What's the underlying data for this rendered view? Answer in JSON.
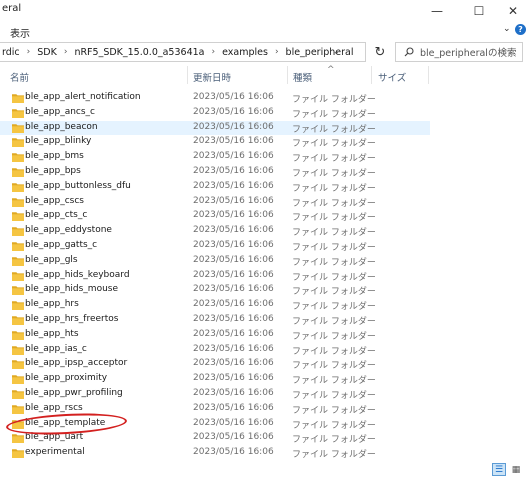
{
  "window": {
    "title": "eral",
    "minimize_glyph": "—",
    "maximize_glyph": "☐",
    "close_glyph": "✕"
  },
  "menu": {
    "view": "表示",
    "expand_glyph": "⌄",
    "help_glyph": "?"
  },
  "address": {
    "crumbs": [
      "rdic",
      "SDK",
      "nRF5_SDK_15.0.0_a53641a",
      "examples",
      "ble_peripheral"
    ],
    "separator": "›",
    "dropdown_glyph": "⌄",
    "refresh_glyph": "↻"
  },
  "search": {
    "placeholder": "ble_peripheralの検索"
  },
  "columns": {
    "name": "名前",
    "modified": "更新日時",
    "type": "種類",
    "size": "サイズ",
    "sort_glyph": "^"
  },
  "files": [
    {
      "name": "ble_app_alert_notification",
      "date": "2023/05/16 16:06",
      "type": "ファイル フォルダー"
    },
    {
      "name": "ble_app_ancs_c",
      "date": "2023/05/16 16:06",
      "type": "ファイル フォルダー"
    },
    {
      "name": "ble_app_beacon",
      "date": "2023/05/16 16:06",
      "type": "ファイル フォルダー"
    },
    {
      "name": "ble_app_blinky",
      "date": "2023/05/16 16:06",
      "type": "ファイル フォルダー"
    },
    {
      "name": "ble_app_bms",
      "date": "2023/05/16 16:06",
      "type": "ファイル フォルダー"
    },
    {
      "name": "ble_app_bps",
      "date": "2023/05/16 16:06",
      "type": "ファイル フォルダー"
    },
    {
      "name": "ble_app_buttonless_dfu",
      "date": "2023/05/16 16:06",
      "type": "ファイル フォルダー"
    },
    {
      "name": "ble_app_cscs",
      "date": "2023/05/16 16:06",
      "type": "ファイル フォルダー"
    },
    {
      "name": "ble_app_cts_c",
      "date": "2023/05/16 16:06",
      "type": "ファイル フォルダー"
    },
    {
      "name": "ble_app_eddystone",
      "date": "2023/05/16 16:06",
      "type": "ファイル フォルダー"
    },
    {
      "name": "ble_app_gatts_c",
      "date": "2023/05/16 16:06",
      "type": "ファイル フォルダー"
    },
    {
      "name": "ble_app_gls",
      "date": "2023/05/16 16:06",
      "type": "ファイル フォルダー"
    },
    {
      "name": "ble_app_hids_keyboard",
      "date": "2023/05/16 16:06",
      "type": "ファイル フォルダー"
    },
    {
      "name": "ble_app_hids_mouse",
      "date": "2023/05/16 16:06",
      "type": "ファイル フォルダー"
    },
    {
      "name": "ble_app_hrs",
      "date": "2023/05/16 16:06",
      "type": "ファイル フォルダー"
    },
    {
      "name": "ble_app_hrs_freertos",
      "date": "2023/05/16 16:06",
      "type": "ファイル フォルダー"
    },
    {
      "name": "ble_app_hts",
      "date": "2023/05/16 16:06",
      "type": "ファイル フォルダー"
    },
    {
      "name": "ble_app_ias_c",
      "date": "2023/05/16 16:06",
      "type": "ファイル フォルダー"
    },
    {
      "name": "ble_app_ipsp_acceptor",
      "date": "2023/05/16 16:06",
      "type": "ファイル フォルダー"
    },
    {
      "name": "ble_app_proximity",
      "date": "2023/05/16 16:06",
      "type": "ファイル フォルダー"
    },
    {
      "name": "ble_app_pwr_profiling",
      "date": "2023/05/16 16:06",
      "type": "ファイル フォルダー"
    },
    {
      "name": "ble_app_rscs",
      "date": "2023/05/16 16:06",
      "type": "ファイル フォルダー"
    },
    {
      "name": "ble_app_template",
      "date": "2023/05/16 16:06",
      "type": "ファイル フォルダー"
    },
    {
      "name": "ble_app_uart",
      "date": "2023/05/16 16:06",
      "type": "ファイル フォルダー"
    },
    {
      "name": "experimental",
      "date": "2023/05/16 16:06",
      "type": "ファイル フォルダー"
    }
  ],
  "highlighted_row": "ble_app_beacon",
  "annotated_row": "ble_app_template",
  "colors": {
    "folder": "#f5c542",
    "folder_tab": "#e0a923",
    "highlight": "#e5f3ff",
    "annotation": "#d3201f",
    "accent": "#1e6fc8"
  },
  "view_buttons": {
    "details_glyph": "☰",
    "tiles_glyph": "▦"
  }
}
